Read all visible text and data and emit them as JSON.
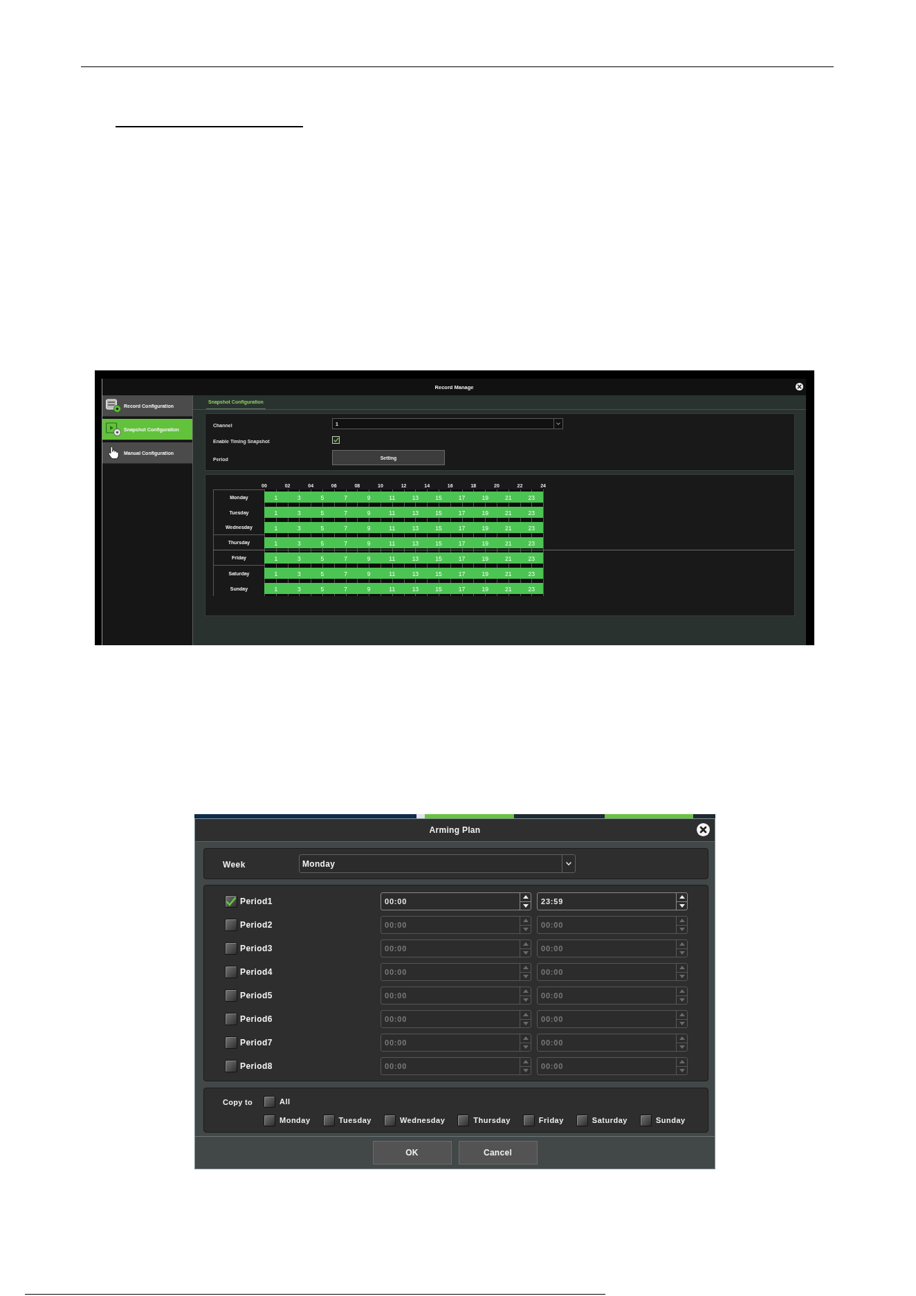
{
  "record_manage": {
    "title": "Record Manage",
    "sidebar": {
      "items": [
        {
          "label": "Record Configuration",
          "selected": false
        },
        {
          "label": "Snapshot Configuration",
          "selected": true
        },
        {
          "label": "Manual Configuration",
          "selected": false
        }
      ]
    },
    "tabs": [
      {
        "label": "Snapshot Configuration",
        "selected": true
      }
    ],
    "form": {
      "channel": {
        "label": "Channel",
        "value": "1"
      },
      "timing": {
        "label": "Enable Timing Snapshot",
        "checked": true
      },
      "period": {
        "label": "Period",
        "button": "Setting"
      }
    },
    "schedule": {
      "hours": [
        "00",
        "02",
        "04",
        "06",
        "08",
        "10",
        "12",
        "14",
        "16",
        "18",
        "20",
        "22",
        "24"
      ],
      "days": [
        {
          "label": "Monday",
          "slots": [
            "1",
            "3",
            "5",
            "7",
            "9",
            "11",
            "13",
            "15",
            "17",
            "19",
            "21",
            "23"
          ]
        },
        {
          "label": "Tuesday",
          "slots": [
            "1",
            "3",
            "5",
            "7",
            "9",
            "11",
            "13",
            "15",
            "17",
            "19",
            "21",
            "23"
          ]
        },
        {
          "label": "Wednesday",
          "slots": [
            "1",
            "3",
            "5",
            "7",
            "9",
            "11",
            "13",
            "15",
            "17",
            "19",
            "21",
            "23"
          ]
        },
        {
          "label": "Thursday",
          "slots": [
            "1",
            "3",
            "5",
            "7",
            "9",
            "11",
            "13",
            "15",
            "17",
            "19",
            "21",
            "23"
          ]
        },
        {
          "label": "Friday",
          "slots": [
            "1",
            "3",
            "5",
            "7",
            "9",
            "11",
            "13",
            "15",
            "17",
            "19",
            "21",
            "23"
          ]
        },
        {
          "label": "Saturday",
          "slots": [
            "1",
            "3",
            "5",
            "7",
            "9",
            "11",
            "13",
            "15",
            "17",
            "19",
            "21",
            "23"
          ]
        },
        {
          "label": "Sunday",
          "slots": [
            "1",
            "3",
            "5",
            "7",
            "9",
            "11",
            "13",
            "15",
            "17",
            "19",
            "21",
            "23"
          ]
        }
      ]
    }
  },
  "arming_plan": {
    "title": "Arming Plan",
    "week": {
      "label": "Week",
      "value": "Monday"
    },
    "periods": [
      {
        "label": "Period1",
        "checked": true,
        "start": "00:00",
        "end": "23:59"
      },
      {
        "label": "Period2",
        "checked": false,
        "start": "00:00",
        "end": "00:00"
      },
      {
        "label": "Period3",
        "checked": false,
        "start": "00:00",
        "end": "00:00"
      },
      {
        "label": "Period4",
        "checked": false,
        "start": "00:00",
        "end": "00:00"
      },
      {
        "label": "Period5",
        "checked": false,
        "start": "00:00",
        "end": "00:00"
      },
      {
        "label": "Period6",
        "checked": false,
        "start": "00:00",
        "end": "00:00"
      },
      {
        "label": "Period7",
        "checked": false,
        "start": "00:00",
        "end": "00:00"
      },
      {
        "label": "Period8",
        "checked": false,
        "start": "00:00",
        "end": "00:00"
      }
    ],
    "copy_to": {
      "label": "Copy to",
      "all": {
        "label": "All",
        "checked": false
      },
      "days": [
        {
          "label": "Monday",
          "checked": false
        },
        {
          "label": "Tuesday",
          "checked": false
        },
        {
          "label": "Wednesday",
          "checked": false
        },
        {
          "label": "Thursday",
          "checked": false
        },
        {
          "label": "Friday",
          "checked": false
        },
        {
          "label": "Saturday",
          "checked": false
        },
        {
          "label": "Sunday",
          "checked": false
        }
      ]
    },
    "buttons": [
      "OK",
      "Cancel"
    ]
  }
}
